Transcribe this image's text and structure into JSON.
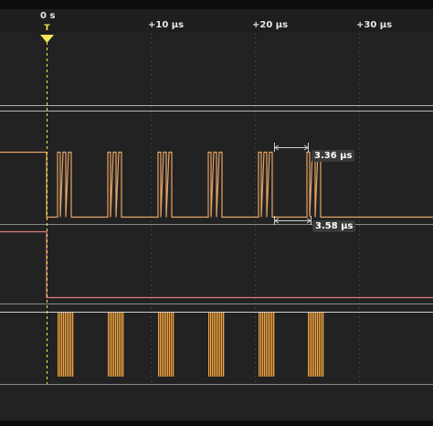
{
  "ruler": {
    "ticks": [
      {
        "id": "tick-0",
        "label": "0 s"
      },
      {
        "id": "tick-10",
        "label": "+10 µs"
      },
      {
        "id": "tick-20",
        "label": "+20 µs"
      },
      {
        "id": "tick-30",
        "label": "+30 µs"
      }
    ],
    "trigger_label": "T"
  },
  "measurements": {
    "upper": "3.36 µs",
    "lower": "3.58 µs"
  },
  "colors": {
    "background": "#222222",
    "grid": "#3a3a3a",
    "trigger": "#f2e65a",
    "channel_sda": "#e6a466",
    "channel_scl": "#f2a33c",
    "channel_pink": "#e07a80",
    "channel_gray": "#d8d8d8",
    "divider": "#b8b8b8"
  }
}
